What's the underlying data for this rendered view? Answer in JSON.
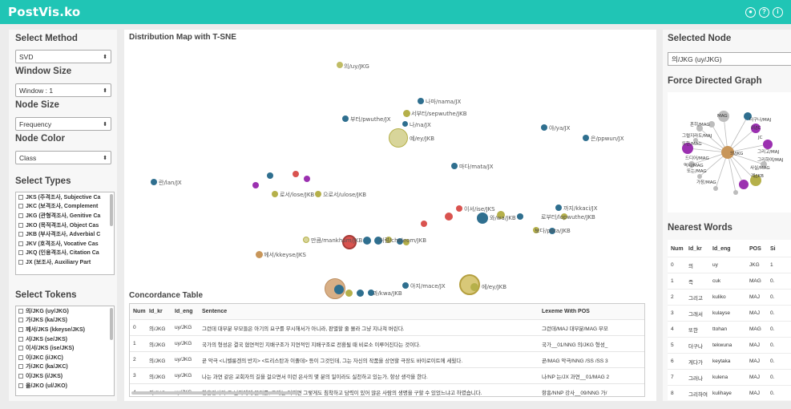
{
  "app": {
    "title": "PostVis.ko"
  },
  "top_icons": [
    "user-icon",
    "help-icon",
    "info-icon"
  ],
  "left": {
    "method_label": "Select Method",
    "method_value": "SVD",
    "window_label": "Window Size",
    "window_value": "Window : 1",
    "node_size_label": "Node Size",
    "node_size_value": "Frequency",
    "node_color_label": "Node Color",
    "node_color_value": "Class",
    "types_label": "Select Types",
    "types": [
      "JKS (주격조사, Subjective Ca",
      "JKC (보격조사, Complement",
      "JKG (관형격조사, Genitive Ca",
      "JKO (목적격조사, Object Cas",
      "JKB (부사격조사, Adverbial C",
      "JKV (호격조사, Vocative Cas",
      "JKQ (인용격조사, Citation Ca",
      "JX (보조사, Auxiliary Part"
    ],
    "tokens_label": "Select Tokens",
    "tokens": [
      "의/JKG (uy/JKG)",
      "가/JKS (ka/JKS)",
      "께서/JKS (kkeyse/JKS)",
      "서/JKS (se/JKS)",
      "이서/JKS (ise/JKS)",
      "이/JKC (i/JKC)",
      "가/JKC (ka/JKC)",
      "이/JKS (i/JKS)",
      "을/JKO (ul/JKO)"
    ]
  },
  "middle": {
    "map_title": "Distribution Map with T-SNE",
    "map_labels": [
      "의/uy/JKG",
      "나마/nama/JX",
      "부터/pwuthe/JX",
      "서부터/sepwuthe/JKB",
      "나/na/JX",
      "야/ya/JX",
      "예/ey/JKB",
      "은/ppwun/JX",
      "란/lan/JX",
      "보다/pota/JKB",
      "이서/ise/JKS",
      "로서/lose/JKB",
      "으로서/ulose/JKB",
      "마다/mata/JX",
      "까지/kkaci/JX",
      "로부터/lopwuthe/JKB",
      "만큼/mankhum/JKB",
      "처럼/cheleom/JKB",
      "아지/mace/JX",
      "과/kwa/JKB",
      "에/ey/JKB",
      "와/wa/JKB",
      "께서/kkeyse/JKS"
    ],
    "concordance_title": "Concordance Table",
    "columns": [
      "Num",
      "Id_kr",
      "Id_eng",
      "Sentence",
      "Lexeme With POS"
    ],
    "rows": [
      {
        "num": "0",
        "kr": "의/JKG",
        "eng": "uy/JKG",
        "sentence": "그런데 대부분 부모들은 아기의 요구를 무시해서가 아니라, 판별할 줄 몰라 그냥 지나쳐 버린다.",
        "lexeme": "그런데/MAJ 대부분/MAG 부모"
      },
      {
        "num": "1",
        "kr": "의/JKG",
        "eng": "uy/JKG",
        "sentence": "국가의 형성은 결국 협연적인 지배구조가 지연적인 지배구조로 전환될 때 비로소 이루어진다는 것이다.",
        "lexeme": "국가__01/NNG 의/JKG 형성_"
      },
      {
        "num": "2",
        "kr": "의/JKG",
        "eng": "uy/JKG",
        "sentence": "곧 악극 <니벨룽겐의 반지> <트리스탄과 이졸데> 등이 그것인데, 그는 자신의 작품을 상연할 극장도 바이로이트에 세웠다.",
        "lexeme": "곧/MAG 악극/NNG /SS /SS 3"
      },
      {
        "num": "3",
        "kr": "의/JKG",
        "eng": "uy/JKG",
        "sentence": "나는 과연 같은 교회자의 길을 걸으면서 이런 은사의 몇 분의 일이라도 실천하고 있는가, 항상 생각을 한다.",
        "lexeme": "나/NP 는/JX 과연__01/MAG 2"
      },
      {
        "num": "4",
        "kr": "의/JKG",
        "eng": "uy/JKG",
        "sentence": "항흥강사가 그 남자에게 물기를, 그대는 어찌면 그렇게도 침착하고 담력이 있어 많은 사람의 생명을 구할 수 있었느냐고 하였습니다.",
        "lexeme": "항흥/NNP 강사__09/NNG 가/"
      }
    ]
  },
  "right": {
    "selected_node_label": "Selected Node",
    "selected_node_value": "의/JKG (uy/JKG)",
    "graph_label": "Force Directed Graph",
    "graph_labels": [
      "MAG",
      "흔히/MAG",
      "그럴지라도/MAJ",
      "또한/MAG",
      "의/JKG",
      "그리고/MAJ",
      "드디어/MAG",
      "JC",
      "그리하여/MAJ",
      "사실/MAG",
      "계/JKB",
      "또는/MAG",
      "더구나/MAJ",
      "이/JC",
      "역시/MAG",
      "가장/MAG"
    ],
    "nearest_label": "Nearest Words",
    "columns": [
      "Num",
      "Id_kr",
      "Id_eng",
      "POS",
      "Si"
    ],
    "rows": [
      {
        "num": "0",
        "kr": "의",
        "eng": "uy",
        "pos": "JKG",
        "si": "1"
      },
      {
        "num": "1",
        "kr": "즉",
        "eng": "cuk",
        "pos": "MAG",
        "si": "0."
      },
      {
        "num": "2",
        "kr": "그리고",
        "eng": "kuliko",
        "pos": "MAJ",
        "si": "0."
      },
      {
        "num": "3",
        "kr": "그래서",
        "eng": "kulayse",
        "pos": "MAJ",
        "si": "0."
      },
      {
        "num": "4",
        "kr": "또한",
        "eng": "ttohan",
        "pos": "MAG",
        "si": "0."
      },
      {
        "num": "5",
        "kr": "더구나",
        "eng": "tekwuna",
        "pos": "MAJ",
        "si": "0."
      },
      {
        "num": "6",
        "kr": "게다가",
        "eng": "keytaka",
        "pos": "MAJ",
        "si": "0."
      },
      {
        "num": "7",
        "kr": "그러나",
        "eng": "kulena",
        "pos": "MAJ",
        "si": "0."
      },
      {
        "num": "8",
        "kr": "그리하여",
        "eng": "kulihaye",
        "pos": "MAJ",
        "si": "0."
      }
    ]
  },
  "colors": {
    "topbar": "#20c5b5",
    "teal_node": "#2f6f8f",
    "olive_node": "#b5b04a",
    "red_node": "#d9534f",
    "purple_node": "#9b30b0",
    "tan_node": "#c8965a"
  }
}
